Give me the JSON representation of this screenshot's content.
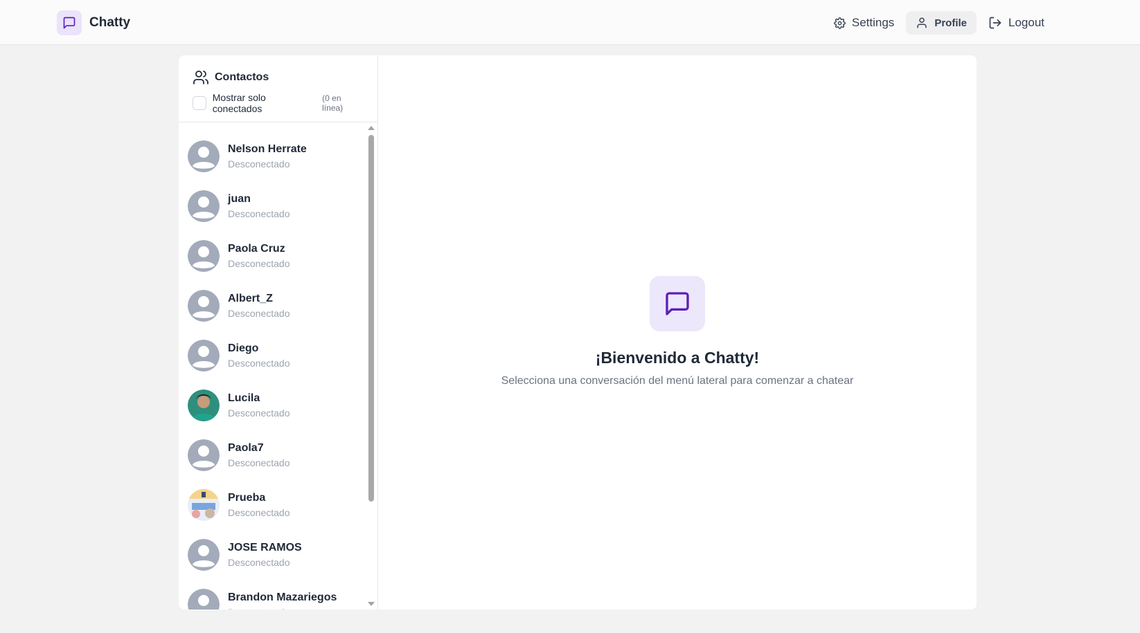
{
  "header": {
    "brand_name": "Chatty",
    "nav": {
      "settings": "Settings",
      "profile": "Profile",
      "logout": "Logout"
    }
  },
  "sidebar": {
    "title": "Contactos",
    "filter_label": "Mostrar solo conectados",
    "online_count": "(0 en línea)",
    "contacts": [
      {
        "name": "Nelson Herrate",
        "status": "Desconectado",
        "avatar": "default"
      },
      {
        "name": "juan",
        "status": "Desconectado",
        "avatar": "default"
      },
      {
        "name": "Paola Cruz",
        "status": "Desconectado",
        "avatar": "default"
      },
      {
        "name": "Albert_Z",
        "status": "Desconectado",
        "avatar": "default"
      },
      {
        "name": "Diego",
        "status": "Desconectado",
        "avatar": "default"
      },
      {
        "name": "Lucila",
        "status": "Desconectado",
        "avatar": "photo"
      },
      {
        "name": "Paola7",
        "status": "Desconectado",
        "avatar": "default"
      },
      {
        "name": "Prueba",
        "status": "Desconectado",
        "avatar": "photo"
      },
      {
        "name": "JOSE RAMOS",
        "status": "Desconectado",
        "avatar": "default"
      },
      {
        "name": "Brandon Mazariegos",
        "status": "Desconectado",
        "avatar": "default"
      }
    ]
  },
  "welcome": {
    "title": "¡Bienvenido a Chatty!",
    "subtitle": "Selecciona una conversación del menú lateral para comenzar a chatear"
  },
  "colors": {
    "accent": "#5b21b6",
    "accent_bg": "#ede7fb",
    "status_offline": "#9ca3af"
  }
}
